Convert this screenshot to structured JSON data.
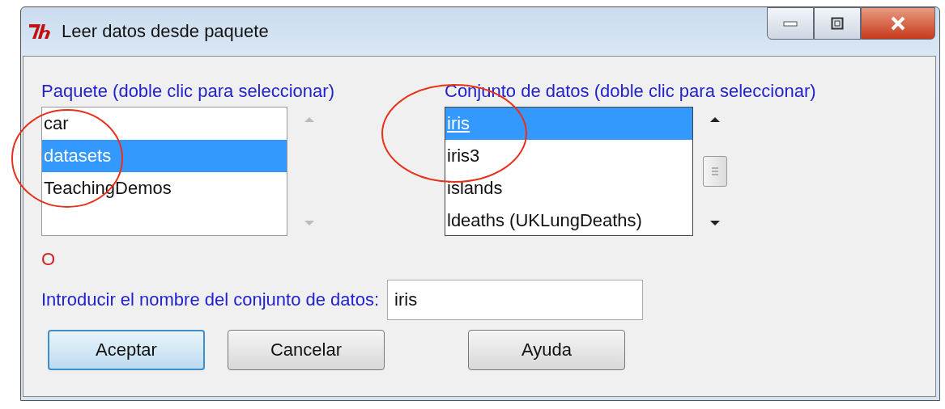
{
  "window": {
    "title": "Leer datos desde paquete"
  },
  "package_list": {
    "label": "Paquete (doble clic para seleccionar)",
    "focused": false,
    "items": [
      {
        "label": "car",
        "selected": false
      },
      {
        "label": "datasets",
        "selected": true
      },
      {
        "label": "TeachingDemos",
        "selected": false
      }
    ]
  },
  "dataset_list": {
    "label": "Conjunto de datos (doble clic para seleccionar)",
    "focused": true,
    "items": [
      {
        "label": "iris",
        "selected": true
      },
      {
        "label": "iris3",
        "selected": false
      },
      {
        "label": "islands",
        "selected": false
      },
      {
        "label": "ldeaths (UKLungDeaths)",
        "selected": false
      }
    ]
  },
  "status": "O",
  "entry": {
    "label": "Introducir el nombre del conjunto de datos:",
    "value": "iris"
  },
  "buttons": [
    {
      "label": "Aceptar",
      "default": true
    },
    {
      "label": "Cancelar",
      "default": false
    },
    {
      "label": "Ayuda",
      "default": false
    }
  ]
}
